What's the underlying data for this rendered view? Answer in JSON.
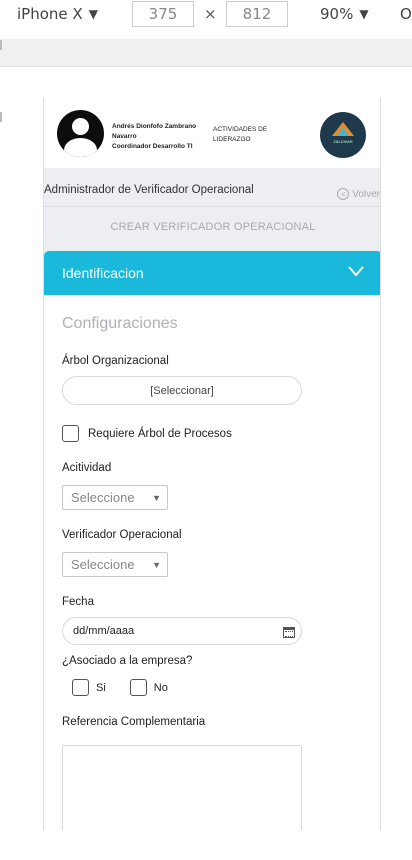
{
  "devtools": {
    "device": "iPhone X",
    "width": "375",
    "height": "812",
    "zoom": "90%",
    "more": "O"
  },
  "header": {
    "user_name_line1": "Andrés Dionfofo Zambrano",
    "user_name_line2": "Navarro",
    "user_role": "Coordinador Desarrollo TI",
    "activity_line1": "ACTIVIDADES DE",
    "activity_line2": "LIDERAZGO",
    "logo_text": "ZALDIVAR"
  },
  "breadcrumb": "Administrador de Verificador Operacional",
  "back_label": "Volver",
  "section_title": "CREAR VERIFICADOR OPERACIONAL",
  "card": {
    "header_title": "Identificacion",
    "subtitle": "Configuraciones",
    "arbol_label": "Árbol Organizacional",
    "arbol_button": "[Seleccionar]",
    "requiere_label": "Requiere Árbol de Procesos",
    "actividad_label": "Acitividad",
    "actividad_select": "Seleccione",
    "verificador_label": "Verificador Operacional",
    "verificador_select": "Seleccione",
    "fecha_label": "Fecha",
    "fecha_placeholder": "dd/mm/aaaa",
    "asociado_label": "¿Asociado a la empresa?",
    "si_label": "Si",
    "no_label": "No",
    "referencia_label": "Referencia Complementaria"
  },
  "colors": {
    "accent": "#1ab8da",
    "page_bg": "#edeef2",
    "logo_bg": "#1e3a4a"
  }
}
